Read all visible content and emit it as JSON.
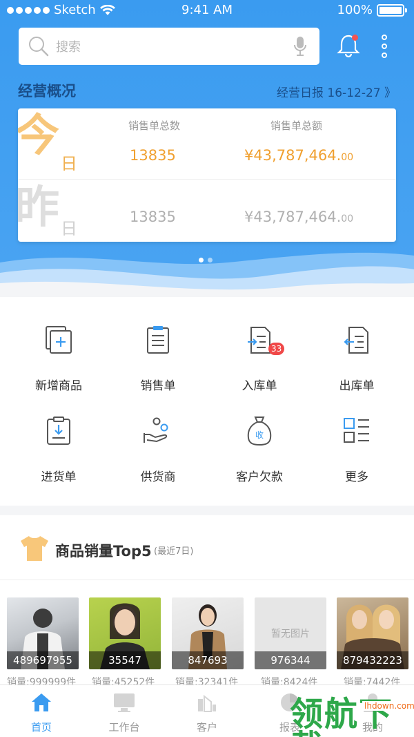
{
  "status_bar": {
    "carrier": "Sketch",
    "time": "9:41 AM",
    "battery": "100%"
  },
  "search": {
    "placeholder": "搜索"
  },
  "overview": {
    "title": "经营概况",
    "report_link": "经营日报 16-12-27 》",
    "col_count": "销售单总数",
    "col_amount": "销售单总额",
    "today_char_big": "今",
    "today_char_small": "日",
    "yesterday_char_big": "昨",
    "yesterday_char_small": "日",
    "today_count": "13835",
    "today_amount": "¥43,787,464.",
    "today_amount_cents": "00",
    "yesterday_count": "13835",
    "yesterday_amount": "¥43,787,464.",
    "yesterday_amount_cents": "00",
    "pager_total": 2,
    "pager_active": 1
  },
  "grid": [
    {
      "label": "新增商品",
      "icon": "add-product-icon"
    },
    {
      "label": "销售单",
      "icon": "sales-order-icon"
    },
    {
      "label": "入库单",
      "icon": "inbound-order-icon",
      "badge": "33"
    },
    {
      "label": "出库单",
      "icon": "outbound-order-icon"
    },
    {
      "label": "进货单",
      "icon": "purchase-order-icon"
    },
    {
      "label": "供货商",
      "icon": "supplier-icon"
    },
    {
      "label": "客户欠款",
      "icon": "customer-debt-icon"
    },
    {
      "label": "更多",
      "icon": "more-grid-icon"
    }
  ],
  "top5": {
    "title": "商品销量Top5",
    "subtitle": "(最近7日)",
    "products": [
      {
        "code": "489697955",
        "sales": "销量:999999件"
      },
      {
        "code": "35547",
        "sales": "销量:45252件"
      },
      {
        "code": "847693",
        "sales": "销量:32341件"
      },
      {
        "code": "976344",
        "sales": "销量:8424件",
        "placeholder": "暂无图片"
      },
      {
        "code": "879432223",
        "sales": "销量:7442件"
      }
    ]
  },
  "tabbar": [
    {
      "label": "首页",
      "icon": "home-icon",
      "active": true
    },
    {
      "label": "工作台",
      "icon": "monitor-icon"
    },
    {
      "label": "客户",
      "icon": "customer-icon"
    },
    {
      "label": "报表",
      "icon": "report-icon"
    },
    {
      "label": "我的",
      "icon": "profile-icon"
    }
  ],
  "watermark": {
    "text": "领航下载",
    "url": "lhdown.com"
  },
  "colors": {
    "primary": "#3a9bf0",
    "accent_orange": "#f0a030",
    "badge_red": "#f04848",
    "title_blue": "#1a4f8a"
  }
}
